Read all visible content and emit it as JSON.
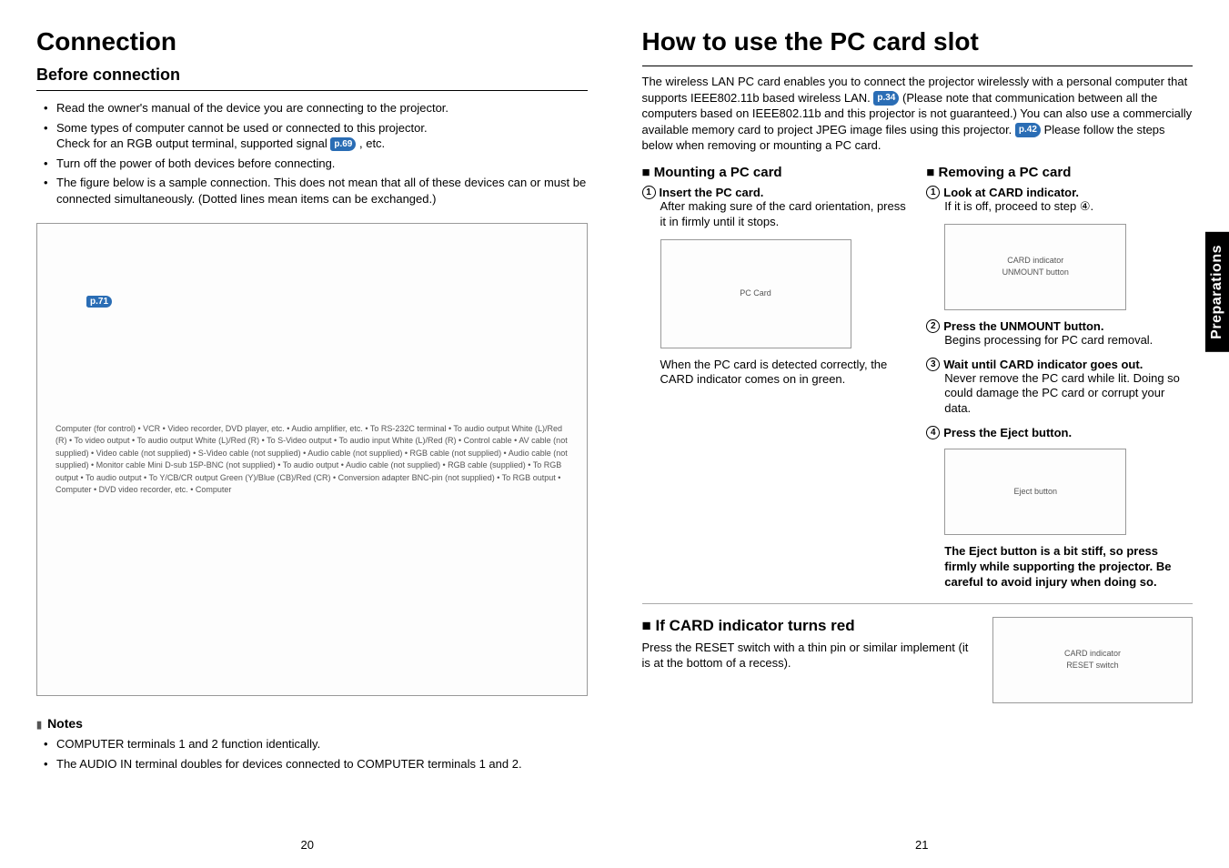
{
  "left": {
    "title": "Connection",
    "subhead": "Before connection",
    "bullets": [
      "Read the owner's manual of the device you are connecting to the projector.",
      "Some types of computer cannot be used or connected to this projector.",
      "Check for an RGB output terminal, supported signal",
      ", etc.",
      "Turn off the power of both devices before connecting.",
      "The figure below is a sample connection. This does not mean that all of these devices can or must be connected simultaneously. (Dotted lines mean items can be exchanged.)"
    ],
    "pref1": "p.69",
    "pref2": "p.71",
    "diagram_labels": "Computer (for control) • VCR • Video recorder, DVD player, etc. • Audio amplifier, etc. • To RS-232C terminal • To audio output White (L)/Red (R) • To video output • To audio output White (L)/Red (R) • To S-Video output • To audio input White (L)/Red (R) • Control cable • AV cable (not supplied) • Video cable (not supplied) • S-Video cable (not supplied) • Audio cable (not supplied) • RGB cable (not supplied) • Audio cable (not supplied) • Monitor cable Mini D-sub 15P-BNC (not supplied) • To audio output • Audio cable (not supplied) • RGB cable (supplied) • To RGB output • To audio output • To Y/CB/CR output Green (Y)/Blue (CB)/Red (CR) • Conversion adapter BNC-pin (not supplied) • To RGB output • Computer • DVD video recorder, etc. • Computer",
    "notes_title": "Notes",
    "notes": [
      "COMPUTER terminals 1 and 2 function identically.",
      "The AUDIO IN terminal doubles for devices connected to COMPUTER terminals 1 and 2."
    ],
    "pagenum": "20"
  },
  "right": {
    "title": "How to use the PC card slot",
    "intro_a": "The wireless LAN PC card enables you to connect the projector wirelessly with a personal computer that supports IEEE802.11b based wireless LAN.",
    "pref1": "p.34",
    "intro_b": "(Please note that communication between all the computers based on IEEE802.11b and this projector is not guaranteed.)  You can also use a commercially available memory card to project JPEG image files using this projector.",
    "pref2": "p.42",
    "intro_c": "Please follow the steps below when removing or mounting a PC card.",
    "mount_title": "Mounting a PC card",
    "mount_step1_head": "Insert the PC card.",
    "mount_step1_body": "After making sure of the card orientation, press it in firmly until it stops.",
    "mount_diag_label": "PC Card",
    "mount_after": "When the PC card is detected correctly, the CARD indicator comes on in green.",
    "remove_title": "Removing a PC card",
    "r1_head": "Look at CARD indicator.",
    "r1_body": "If it is off, proceed to step ④.",
    "r1_diag_labels": "CARD indicator\nUNMOUNT button",
    "r2_head": "Press the UNMOUNT button.",
    "r2_body": "Begins processing for PC card removal.",
    "r3_head": "Wait until CARD indicator goes out.",
    "r3_body": "Never remove the PC card while lit. Doing so could damage the PC card or corrupt your data.",
    "r4_head": "Press the Eject button.",
    "r4_diag_label": "Eject button",
    "r4_caption": "The Eject button is a bit stiff, so press firmly while supporting the projector. Be careful to avoid injury when doing so.",
    "red_title": "If CARD indicator turns red",
    "red_body": "Press the RESET switch with a thin pin or similar implement (it is at the bottom of a recess).",
    "red_diag_labels": "CARD indicator\nRESET switch",
    "side_tab": "Preparations",
    "pagenum": "21"
  }
}
